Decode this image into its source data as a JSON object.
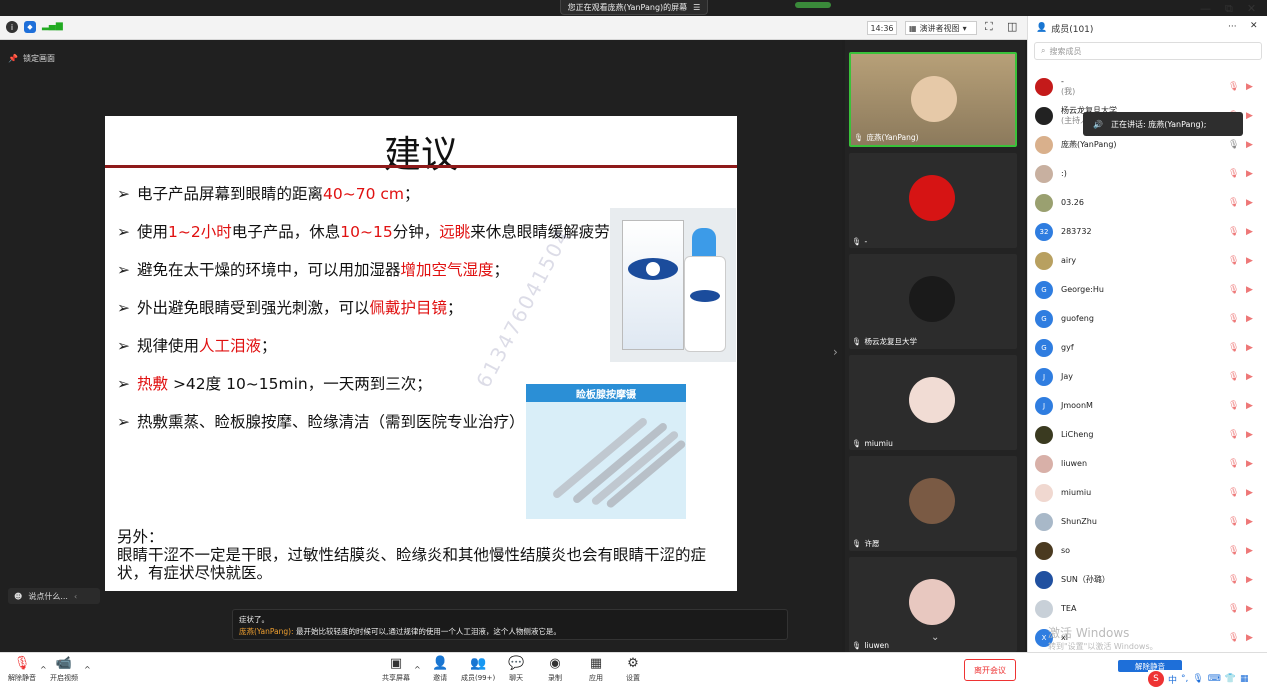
{
  "banner": {
    "text": "您正在观看庞燕(YanPang)的屏幕",
    "icon": "list-icon"
  },
  "topbar": {
    "time": "14:36",
    "view_label": "演讲者视图",
    "members_label": "成员(101)"
  },
  "lock": {
    "label": "锁定画面"
  },
  "slide": {
    "title": "建议",
    "bullets": [
      {
        "parts": [
          {
            "t": "电子产品屏幕到眼睛的距离"
          },
          {
            "t": "40~70 cm",
            "red": true
          },
          {
            "t": "；"
          }
        ]
      },
      {
        "parts": [
          {
            "t": "使用"
          },
          {
            "t": "1~2小时",
            "red": true
          },
          {
            "t": "电子产品，休息"
          },
          {
            "t": "10~15",
            "red": true
          },
          {
            "t": "分钟，"
          },
          {
            "t": "远眺",
            "red": true
          },
          {
            "t": "来休息眼睛缓解疲劳"
          }
        ]
      },
      {
        "parts": [
          {
            "t": "避免在太干燥的环境中，可以用加湿器"
          },
          {
            "t": "增加空气湿度",
            "red": true
          },
          {
            "t": "；"
          }
        ]
      },
      {
        "parts": [
          {
            "t": "外出避免眼睛受到强光刺激，可以"
          },
          {
            "t": "佩戴护目镜",
            "red": true
          },
          {
            "t": "；"
          }
        ]
      },
      {
        "parts": [
          {
            "t": "规律使用"
          },
          {
            "t": "人工泪液",
            "red": true
          },
          {
            "t": "；"
          }
        ]
      },
      {
        "parts": [
          {
            "t": "热敷",
            "red": true
          },
          {
            "t": " >42度 10~15min，一天两到三次；"
          }
        ],
        "redmark": true
      },
      {
        "parts": [
          {
            "t": "热敷熏蒸、睑板腺按摩、睑缘清洁（需到医院专业治疗）"
          }
        ]
      }
    ],
    "massager_label": "睑板腺按摩镊",
    "watermark": "613476041504",
    "extra_title": "另外：",
    "extra_text": "眼睛干涩不一定是干眼，过敏性结膜炎、睑缘炎和其他慢性结膜炎也会有眼睛干涩的症状，有症状尽快就医。"
  },
  "chat_input": {
    "placeholder": "说点什么..."
  },
  "caption": {
    "line1": "症状了。",
    "speaker": "庞燕(YanPang):",
    "line2": "最开始比较轻度的时候可以,通过规律的使用一个人工泪液，这个人物侧液它是。"
  },
  "gallery": [
    {
      "name": "庞燕(YanPang)",
      "color": "#bfa888",
      "avatar": "#e6c9a8"
    },
    {
      "name": "-",
      "color": "#2c2c2c",
      "avatar": "#d61414"
    },
    {
      "name": "杨云龙复旦大学",
      "color": "#2c2c2c",
      "avatar": "#1a1a1a"
    },
    {
      "name": "miumiu",
      "color": "#2c2c2c",
      "avatar": "#f1dcd4"
    },
    {
      "name": "许愿",
      "color": "#2c2c2c",
      "avatar": "#7a5a44"
    },
    {
      "name": "liuwen",
      "color": "#2c2c2c",
      "avatar": "#e8c8c0"
    }
  ],
  "members": {
    "search_placeholder": "搜索成员",
    "list": [
      {
        "name": "-",
        "sub": "(我)",
        "color": "#c41a1a"
      },
      {
        "name": "杨云龙复旦大学",
        "sub": "(主持人)",
        "color": "#222"
      },
      {
        "name": "庞燕(YanPang)",
        "sub": "",
        "color": "#d9b08c"
      },
      {
        "name": ":)",
        "sub": "",
        "color": "#c8b0a0"
      },
      {
        "name": "03.26",
        "sub": "",
        "color": "#9aa070"
      },
      {
        "name": "283732",
        "sub": "",
        "color": "#2f7de0",
        "initial": "32"
      },
      {
        "name": "airy",
        "sub": "",
        "color": "#b8a060"
      },
      {
        "name": "George:Hu",
        "sub": "",
        "color": "#2f7de0",
        "initial": "G"
      },
      {
        "name": "guofeng",
        "sub": "",
        "color": "#2f7de0",
        "initial": "G"
      },
      {
        "name": "gyf",
        "sub": "",
        "color": "#2f7de0",
        "initial": "G"
      },
      {
        "name": "Jay",
        "sub": "",
        "color": "#2f7de0",
        "initial": "J"
      },
      {
        "name": "JmoonM",
        "sub": "",
        "color": "#2f7de0",
        "initial": "J"
      },
      {
        "name": "LiCheng",
        "sub": "",
        "color": "#3a3a20"
      },
      {
        "name": "liuwen",
        "sub": "",
        "color": "#d8b0a8"
      },
      {
        "name": "miumiu",
        "sub": "",
        "color": "#f0d8d0"
      },
      {
        "name": "ShunZhu",
        "sub": "",
        "color": "#a8b8c8"
      },
      {
        "name": "so",
        "sub": "",
        "color": "#4a3a20"
      },
      {
        "name": "SUN（孙璐）",
        "sub": "",
        "color": "#2050a0"
      },
      {
        "name": "TEA",
        "sub": "",
        "color": "#c8d0d8"
      },
      {
        "name": "xl",
        "sub": "",
        "color": "#2f7de0",
        "initial": "X"
      }
    ],
    "speaking_tip": "正在讲话: 庞燕(YanPang);",
    "unmute_all": "解除静音"
  },
  "activation": {
    "title": "激活 Windows",
    "sub": "转到\"设置\"以激活 Windows。"
  },
  "toolbar": {
    "unmute": "解除静音",
    "video": "开启视频",
    "share": "共享屏幕",
    "invite": "邀请",
    "members": "成员(99+)",
    "chat": "聊天",
    "record": "录制",
    "apps": "应用",
    "settings": "设置",
    "leave": "离开会议"
  },
  "ime": {
    "label": "中"
  }
}
